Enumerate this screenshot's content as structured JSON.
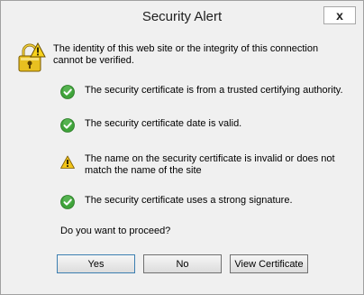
{
  "window": {
    "title": "Security Alert",
    "close_label": "x"
  },
  "intro": "The identity of this web site or the integrity of this connection cannot be verified.",
  "checks": [
    {
      "status": "ok",
      "icon": "checkmark-icon",
      "text": "The security certificate is from a trusted certifying authority."
    },
    {
      "status": "ok",
      "icon": "checkmark-icon",
      "text": "The security certificate date is valid."
    },
    {
      "status": "warning",
      "icon": "warning-icon",
      "text": "The name on the security certificate is invalid or does not match the name of the site"
    },
    {
      "status": "ok",
      "icon": "checkmark-icon",
      "text": "The security certificate uses a strong signature."
    }
  ],
  "question": "Do you want to proceed?",
  "buttons": {
    "yes": "Yes",
    "no": "No",
    "view_certificate": "View Certificate"
  },
  "colors": {
    "ok": "#3fa33a",
    "warning": "#f2c418",
    "lock": "#e8c020"
  }
}
